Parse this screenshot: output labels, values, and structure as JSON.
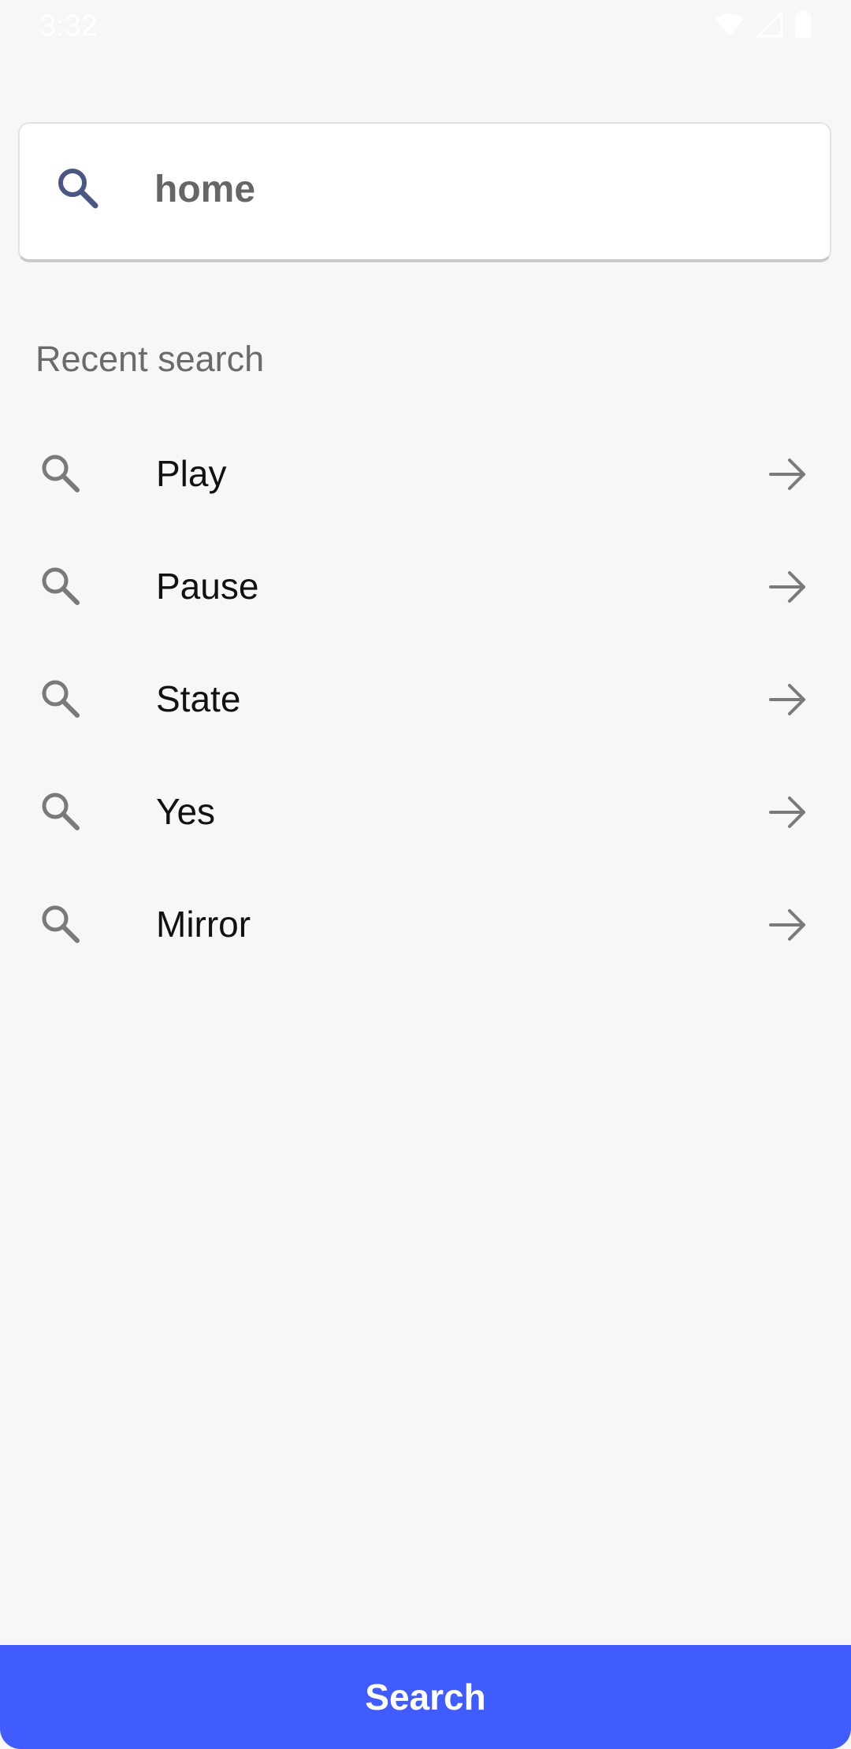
{
  "status_bar": {
    "time": "3:32",
    "icons": [
      "wifi-icon",
      "signal-icon",
      "battery-icon"
    ]
  },
  "search": {
    "value": "home",
    "icon": "search-icon"
  },
  "recent": {
    "title": "Recent search",
    "items": [
      {
        "label": "Play"
      },
      {
        "label": "Pause"
      },
      {
        "label": "State"
      },
      {
        "label": "Yes"
      },
      {
        "label": "Mirror"
      }
    ]
  },
  "bottom_button": {
    "label": "Search"
  },
  "colors": {
    "background": "#f7f7f7",
    "accent": "#405cff",
    "search_icon": "#4a5684",
    "muted_icon": "#7a7a7a"
  }
}
